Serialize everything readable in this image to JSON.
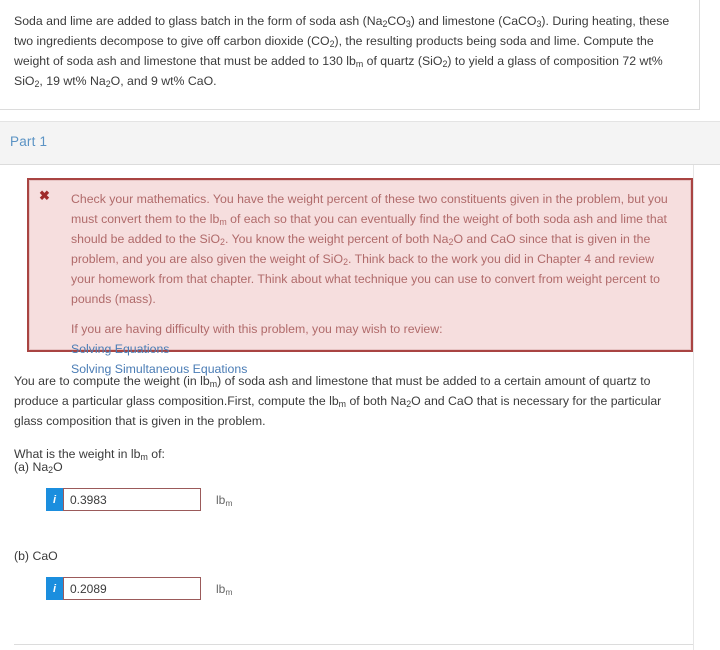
{
  "problem": {
    "statement_html": "Soda and lime are added to glass batch in the form of soda ash (Na<sub>2</sub>CO<sub>3</sub>) and limestone (CaCO<sub>3</sub>). During heating, these two ingredients decompose to give off carbon dioxide (CO<sub>2</sub>), the resulting products being soda and lime. Compute the weight of soda ash and limestone that must be added to 130 lb<sub>m</sub> of quartz (SiO<sub>2</sub>) to yield a glass of composition 72 wt% SiO<sub>2</sub>, 19 wt% Na<sub>2</sub>O, and 9 wt% CaO."
  },
  "part": {
    "title": "Part 1"
  },
  "alert": {
    "icon": "x-mark",
    "message_html": "Check your mathematics. You have the weight percent of these two constituents given in the problem, but you must convert them to the lb<sub>m</sub> of each so that you can eventually find the weight of both soda ash and lime that should be added to the SiO<sub>2</sub>. You know the weight percent of both Na<sub>2</sub>O and CaO since that is given in the problem, and you are also given the weight of SiO<sub>2</sub>. Think back to the work you did in Chapter 4 and review your homework from that chapter. Think about what technique you can use to convert from weight percent to pounds (mass).",
    "review_prompt": "If you are having difficulty with this problem, you may wish to review:",
    "links": [
      "Solving Equations",
      "Solving Simultaneous Equations"
    ],
    "colors": {
      "border": "#a94442",
      "background": "#f6dede",
      "text": "#b06a6a",
      "link": "#4a7cb5",
      "icon": "#a02b2b"
    }
  },
  "body": {
    "paragraph1_html": "You are to compute the weight (in lb<sub>m</sub>) of soda ash and limestone that must be added to a certain amount of quartz to produce a particular glass composition.First, compute the lb<sub>m</sub> of both Na<sub>2</sub>O and CaO that is necessary for the particular glass composition that is given in the problem.",
    "paragraph2_html": "What is the weight in lb<sub>m</sub> of:"
  },
  "answers": [
    {
      "label_html": "(a) Na<sub>2</sub>O",
      "info_icon": "i",
      "value": "0.3983",
      "placeholder": "",
      "unit_html": "lb<sub>m</sub>"
    },
    {
      "label_html": "(b) CaO",
      "info_icon": "i",
      "value": "0.2089",
      "placeholder": "",
      "unit_html": "lb<sub>m</sub>"
    }
  ],
  "theme": {
    "accent_blue": "#1b8ede",
    "header_blue": "#5b93c4",
    "input_border": "#9b5a5a",
    "panel_border": "#dcdcdc",
    "band_background": "#f4f4f4"
  }
}
